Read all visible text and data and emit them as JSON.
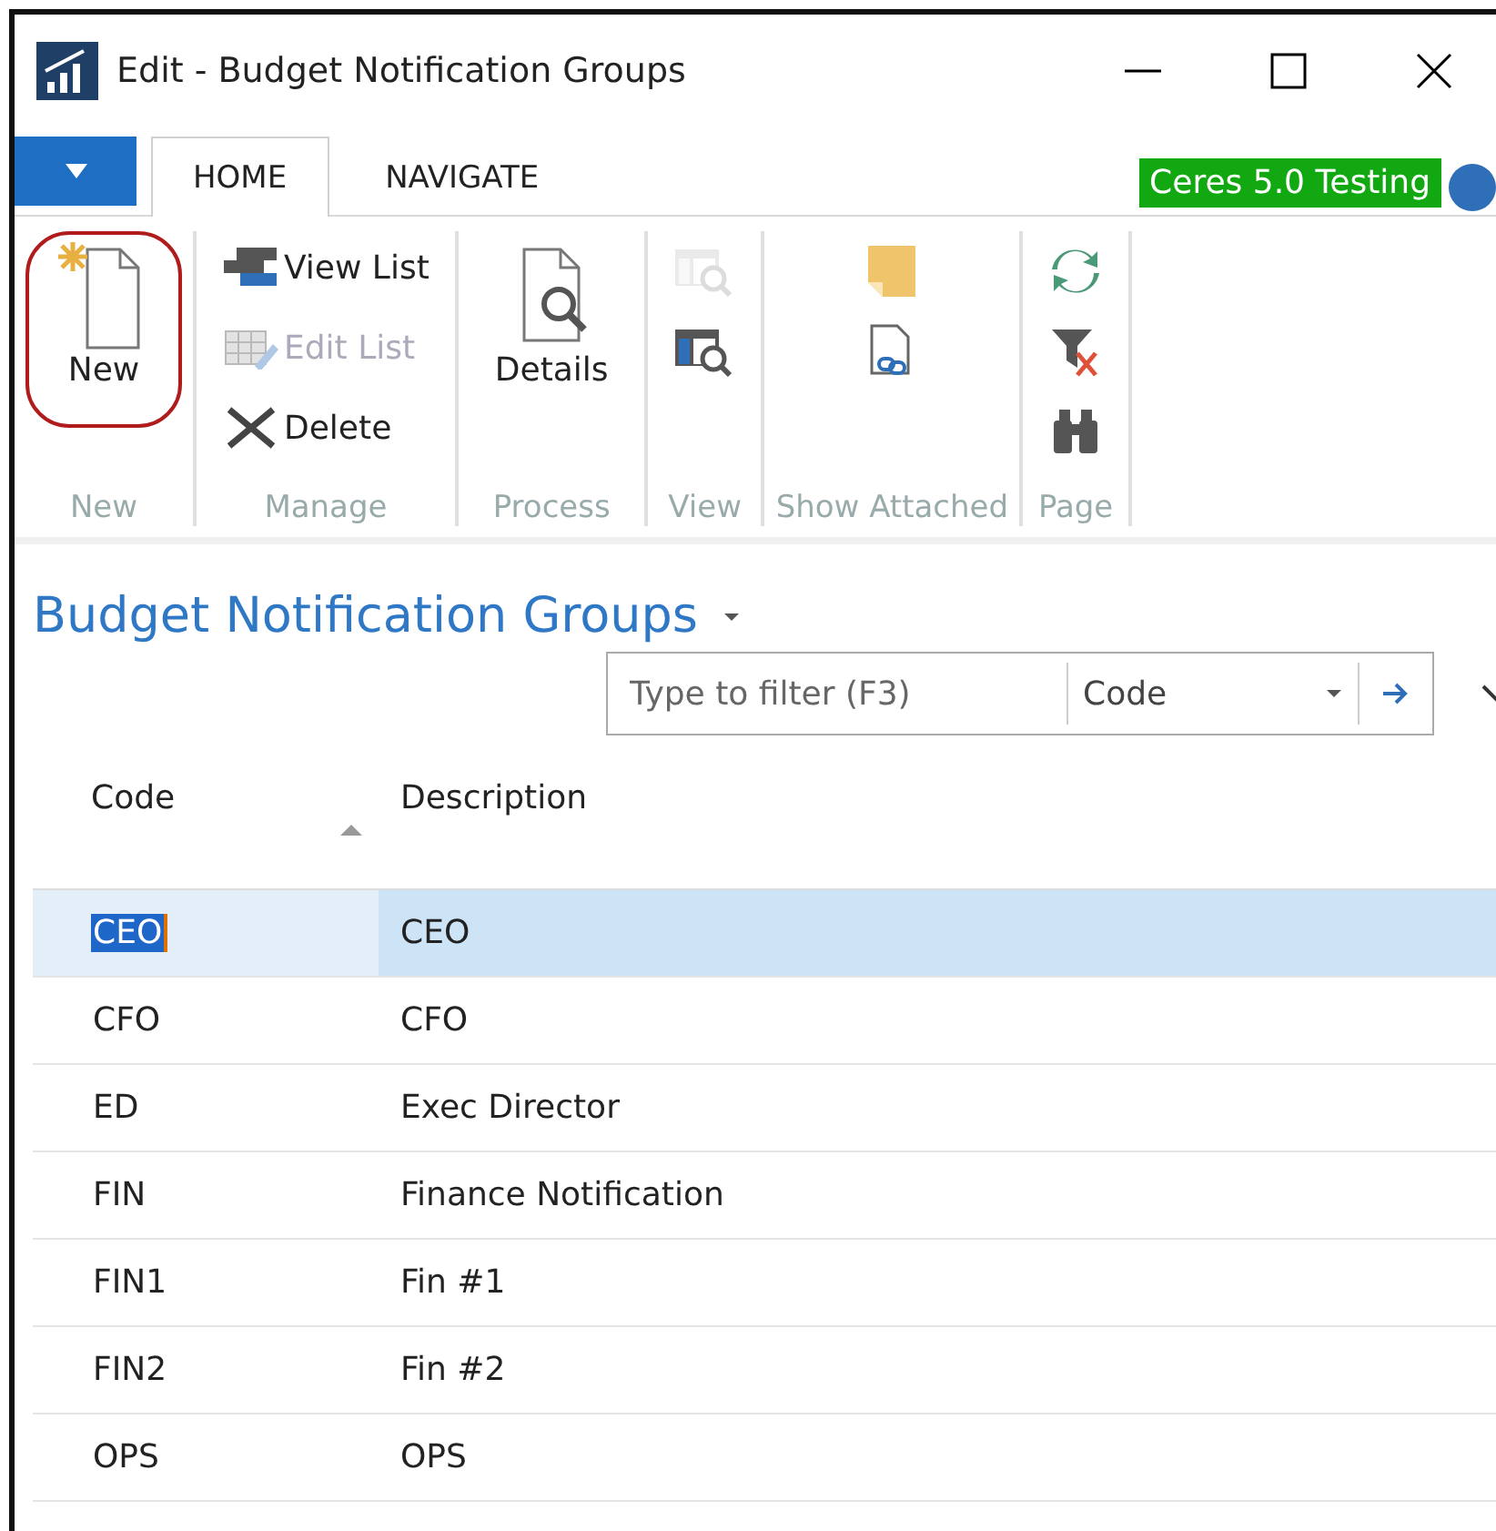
{
  "window": {
    "title": "Edit - Budget Notification Groups"
  },
  "tabs": [
    {
      "label": "HOME",
      "selected": true
    },
    {
      "label": "NAVIGATE",
      "selected": false
    }
  ],
  "environment_badge": "Ceres 5.0 Testing",
  "ribbon": [
    {
      "label": "New",
      "items": [
        {
          "kind": "large",
          "label": "New",
          "disabled": false,
          "highlighted": true
        }
      ]
    },
    {
      "label": "Manage",
      "items": [
        {
          "kind": "small",
          "label": "View List",
          "disabled": false
        },
        {
          "kind": "small",
          "label": "Edit List",
          "disabled": true
        },
        {
          "kind": "small",
          "label": "Delete",
          "disabled": false
        }
      ]
    },
    {
      "label": "Process",
      "items": [
        {
          "kind": "large",
          "label": "Details",
          "disabled": false,
          "highlighted": false
        }
      ]
    },
    {
      "label": "View",
      "items": [
        {
          "kind": "icon",
          "disabled": true
        },
        {
          "kind": "icon",
          "disabled": false
        }
      ]
    },
    {
      "label": "Show Attached",
      "items": [
        {
          "kind": "icon",
          "disabled": false
        },
        {
          "kind": "icon",
          "disabled": false
        }
      ]
    },
    {
      "label": "Page",
      "items": [
        {
          "kind": "icon",
          "disabled": false
        },
        {
          "kind": "icon",
          "disabled": false
        },
        {
          "kind": "icon",
          "disabled": false
        }
      ]
    }
  ],
  "page_title": "Budget Notification Groups",
  "filter": {
    "placeholder": "Type to filter (F3)",
    "field": "Code"
  },
  "table": {
    "columns": [
      {
        "label": "Code",
        "sorted": true
      },
      {
        "label": "Description",
        "sorted": false
      }
    ],
    "rows": [
      {
        "code": "CEO",
        "description": "CEO",
        "selected": true
      },
      {
        "code": "CFO",
        "description": "CFO",
        "selected": false
      },
      {
        "code": "ED",
        "description": "Exec Director",
        "selected": false
      },
      {
        "code": "FIN",
        "description": "Finance Notification",
        "selected": false
      },
      {
        "code": "FIN1",
        "description": "Fin #1",
        "selected": false
      },
      {
        "code": "FIN2",
        "description": "Fin #2",
        "selected": false
      },
      {
        "code": "OPS",
        "description": "OPS",
        "selected": false
      }
    ]
  }
}
